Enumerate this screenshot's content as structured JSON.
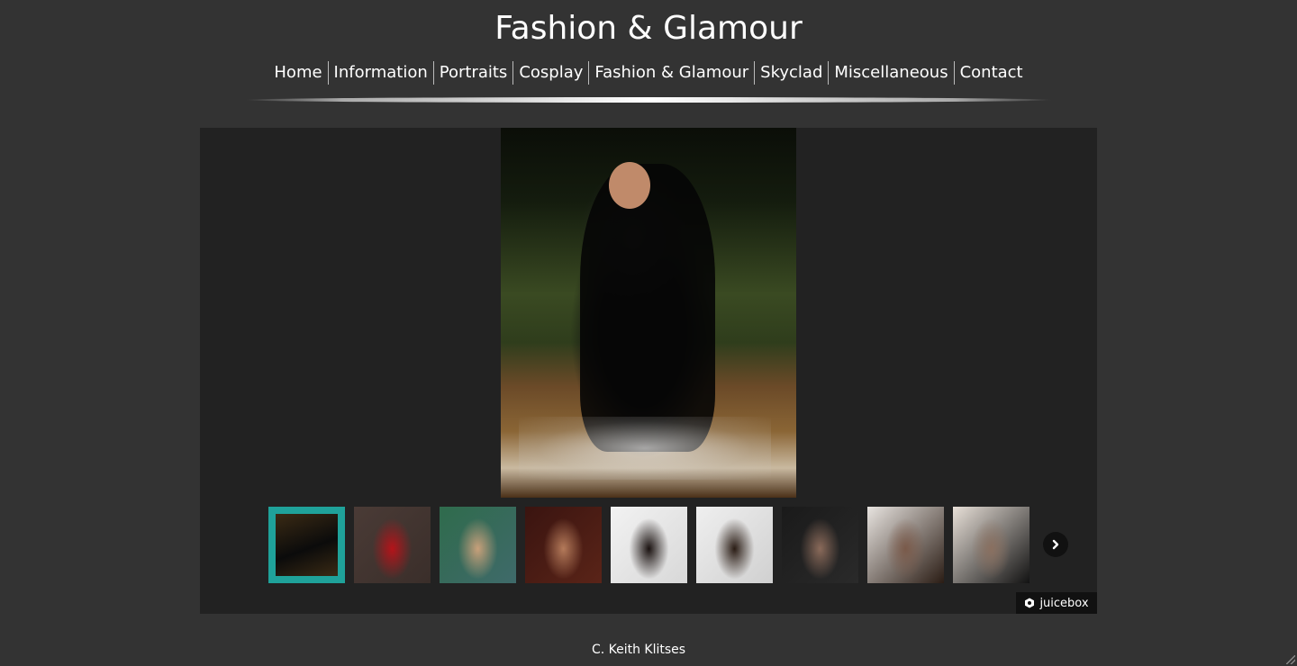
{
  "site": {
    "title": "Fashion & Glamour"
  },
  "nav": {
    "items": [
      {
        "label": "Home"
      },
      {
        "label": "Information"
      },
      {
        "label": "Portraits"
      },
      {
        "label": "Cosplay"
      },
      {
        "label": "Fashion & Glamour"
      },
      {
        "label": "Skyclad"
      },
      {
        "label": "Miscellaneous"
      },
      {
        "label": "Contact"
      }
    ]
  },
  "gallery": {
    "main_image": {
      "subject": "Woman in black dress seated on waterfall steps"
    },
    "thumbnails": [
      {
        "subject": "black dress waterfall",
        "colors": [
          "#1fa29a",
          "#3a2a14",
          "#0b0b0b"
        ],
        "active": true
      },
      {
        "subject": "red dress",
        "colors": [
          "#4a3b36",
          "#b4141a",
          "#3a2e2a"
        ],
        "active": false
      },
      {
        "subject": "seated woman teal background",
        "colors": [
          "#2f6b4c",
          "#c8a07a",
          "#3f6a6a"
        ],
        "active": false
      },
      {
        "subject": "woman on leather chair",
        "colors": [
          "#3a1410",
          "#b47a5a",
          "#5a2418"
        ],
        "active": false
      },
      {
        "subject": "silhouette",
        "colors": [
          "#f2f2f2",
          "#1a1210",
          "#d8d8d8"
        ],
        "active": false
      },
      {
        "subject": "hair flip",
        "colors": [
          "#efefef",
          "#2a1c14",
          "#d0d0d0"
        ],
        "active": false
      },
      {
        "subject": "profile portrait",
        "colors": [
          "#1a1a1a",
          "#8a6a5a",
          "#2a2a2a"
        ],
        "active": false
      },
      {
        "subject": "portrait with long hair",
        "colors": [
          "#e8e4e0",
          "#7a5a4a",
          "#2a1c14"
        ],
        "active": false
      },
      {
        "subject": "fur collar",
        "colors": [
          "#e8e0d8",
          "#8a7060",
          "#121212"
        ],
        "active": false
      }
    ],
    "next_icon": "chevron-right-icon",
    "badge": {
      "label": "juicebox",
      "icon": "juicebox-logo-icon"
    }
  },
  "footer": {
    "text": "C. Keith Klitses"
  },
  "colors": {
    "page_bg": "#333333",
    "gallery_bg": "#222222",
    "active_thumb_border": "#1fa29a"
  }
}
